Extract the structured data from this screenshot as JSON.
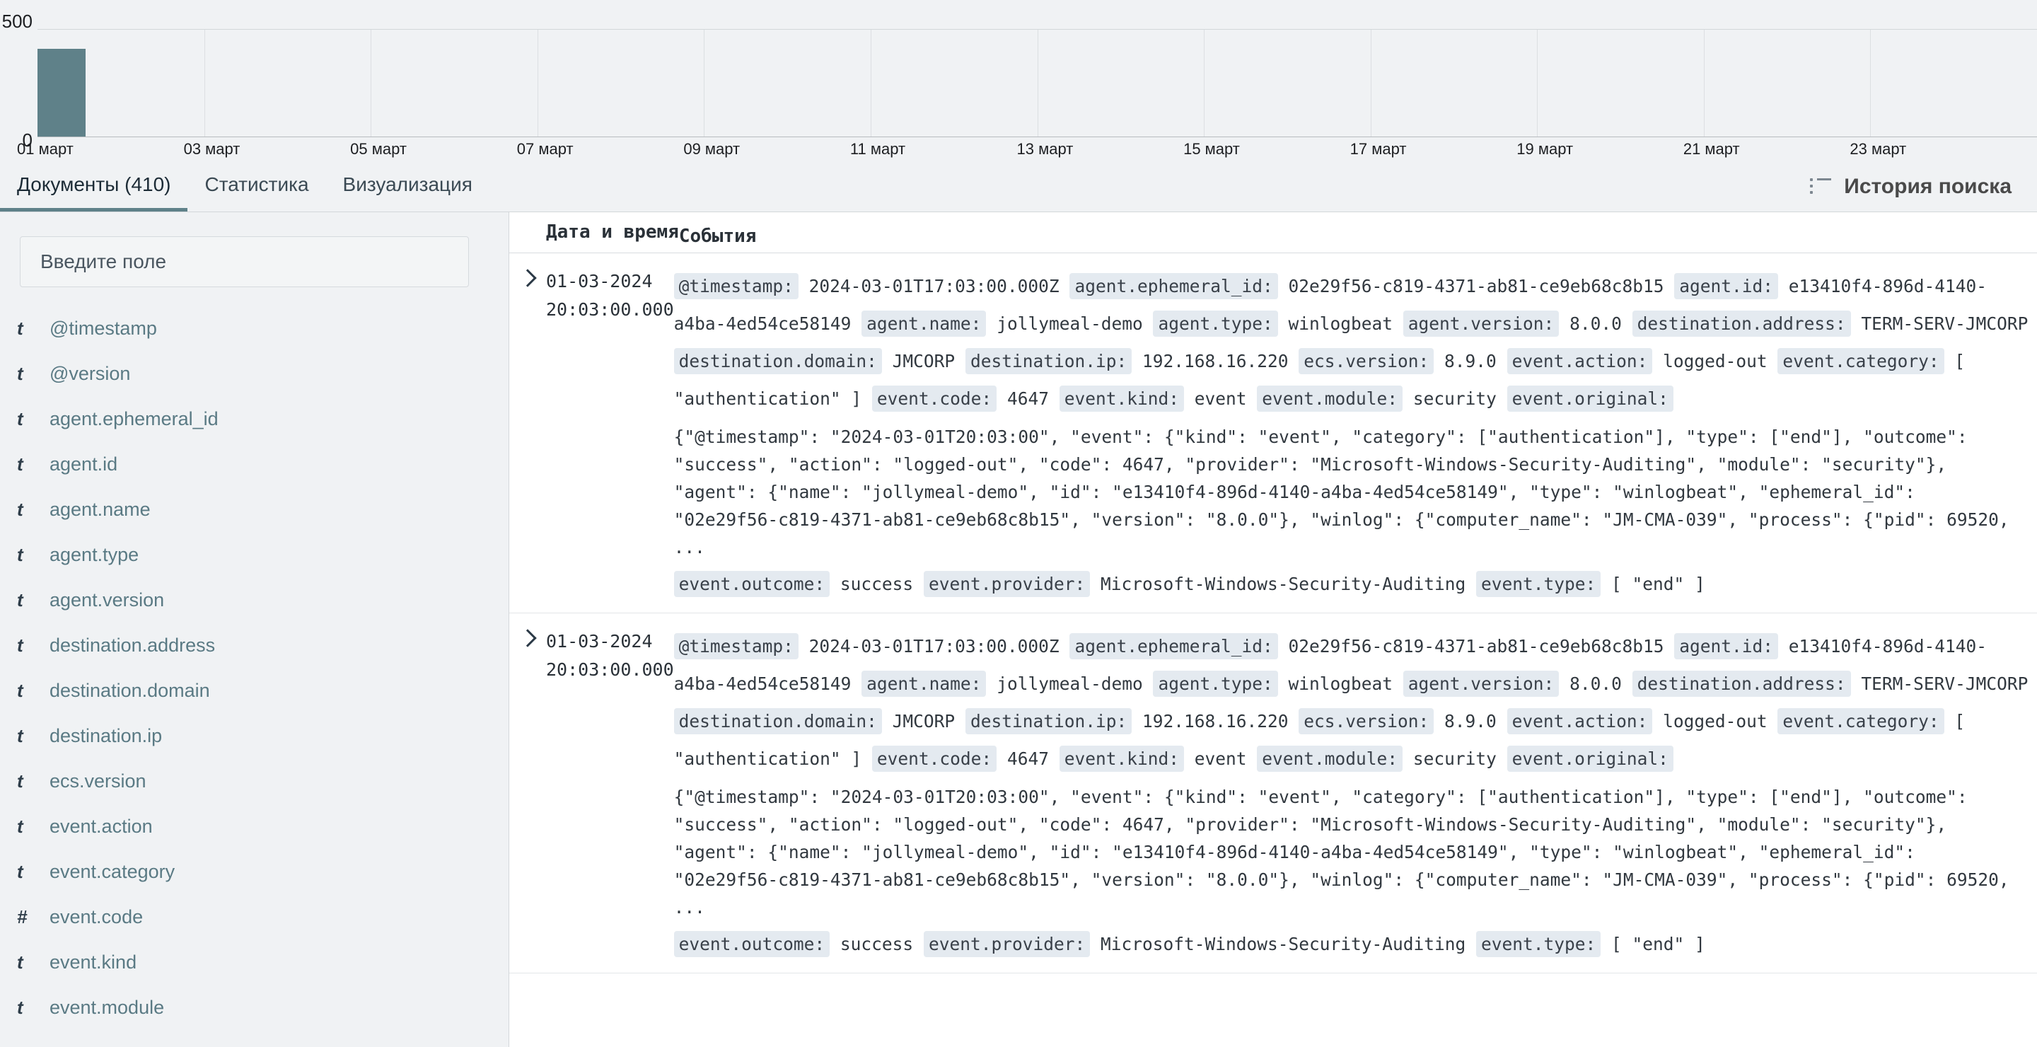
{
  "chart_data": {
    "type": "bar",
    "title": "",
    "xlabel": "",
    "ylabel": "",
    "categories": [
      "01 март",
      "03 март",
      "05 март",
      "07 март",
      "09 март",
      "11 март",
      "13 март",
      "15 март",
      "17 март",
      "19 март",
      "21 март",
      "23 март"
    ],
    "ticks": [
      "01 март",
      "03 март",
      "05 март",
      "07 март",
      "09 март",
      "11 март",
      "13 март",
      "15 март",
      "17 март",
      "19 март",
      "21 март",
      "23 март"
    ],
    "ylim": [
      0,
      500
    ],
    "ytick_labels": [
      "500",
      "0"
    ],
    "grid": true,
    "legend": "none",
    "bars": [
      {
        "label": "01 март",
        "value": 410,
        "color": "#5f8189"
      }
    ],
    "bar_color": "#5f8189"
  },
  "tabs": [
    {
      "label": "Документы (410)",
      "active": true
    },
    {
      "label": "Статистика",
      "active": false
    },
    {
      "label": "Визуализация",
      "active": false
    }
  ],
  "header": {
    "search_history_label": "История поиска",
    "search_history_icon": "list-icon"
  },
  "sidebar": {
    "search_placeholder": "Введите поле",
    "search_value": "",
    "fields": [
      {
        "type": "t",
        "name": "@timestamp"
      },
      {
        "type": "t",
        "name": "@version"
      },
      {
        "type": "t",
        "name": "agent.ephemeral_id"
      },
      {
        "type": "t",
        "name": "agent.id"
      },
      {
        "type": "t",
        "name": "agent.name"
      },
      {
        "type": "t",
        "name": "agent.type"
      },
      {
        "type": "t",
        "name": "agent.version"
      },
      {
        "type": "t",
        "name": "destination.address"
      },
      {
        "type": "t",
        "name": "destination.domain"
      },
      {
        "type": "t",
        "name": "destination.ip"
      },
      {
        "type": "t",
        "name": "ecs.version"
      },
      {
        "type": "t",
        "name": "event.action"
      },
      {
        "type": "t",
        "name": "event.category"
      },
      {
        "type": "#",
        "name": "event.code"
      },
      {
        "type": "t",
        "name": "event.kind"
      },
      {
        "type": "t",
        "name": "event.module"
      }
    ]
  },
  "table": {
    "columns": {
      "time": "Дата и время",
      "events": "События"
    },
    "rows": [
      {
        "date": "01-03-2024",
        "time": "20:03:00.000",
        "pairs_line1": [
          {
            "key": "@timestamp:",
            "val": "2024-03-01T17:03:00.000Z"
          },
          {
            "key": "agent.ephemeral_id:",
            "val": "02e29f56-c819-4371-ab81-ce9eb68c8b15"
          },
          {
            "key": "agent.id:",
            "val": ""
          }
        ],
        "pairs_line2": [
          {
            "key": "",
            "val": "e13410f4-896d-4140-a4ba-4ed54ce58149"
          },
          {
            "key": "agent.name:",
            "val": "jollymeal-demo"
          },
          {
            "key": "agent.type:",
            "val": "winlogbeat"
          },
          {
            "key": "agent.version:",
            "val": "8.0.0"
          }
        ],
        "pairs_line3": [
          {
            "key": "destination.address:",
            "val": "TERM-SERV-JMCORP"
          },
          {
            "key": "destination.domain:",
            "val": "JMCORP"
          },
          {
            "key": "destination.ip:",
            "val": "192.168.16.220"
          },
          {
            "key": "ecs.version:",
            "val": "8.9.0"
          }
        ],
        "pairs_line4": [
          {
            "key": "event.action:",
            "val": "logged-out"
          },
          {
            "key": "event.category:",
            "val": "[ \"authentication\" ]"
          },
          {
            "key": "event.code:",
            "val": "4647"
          },
          {
            "key": "event.kind:",
            "val": "event"
          },
          {
            "key": "event.module:",
            "val": ""
          }
        ],
        "pairs_line5": [
          {
            "key": "",
            "val": "security"
          },
          {
            "key": "event.original:",
            "val": ""
          }
        ],
        "json_original": "{\"@timestamp\": \"2024-03-01T20:03:00\", \"event\": {\"kind\": \"event\", \"category\": [\"authentication\"], \"type\": [\"end\"], \"outcome\": \"success\", \"action\": \"logged-out\", \"code\": 4647, \"provider\": \"Microsoft-Windows-Security-Auditing\", \"module\": \"security\"}, \"agent\": {\"name\": \"jollymeal-demo\", \"id\": \"e13410f4-896d-4140-a4ba-4ed54ce58149\", \"type\": \"winlogbeat\", \"ephemeral_id\": \"02e29f56-c819-4371-ab81-ce9eb68c8b15\", \"version\": \"8.0.0\"}, \"winlog\": {\"computer_name\": \"JM-CMA-039\", \"process\": {\"pid\": 69520, ...",
        "pairs_line6": [
          {
            "key": "event.outcome:",
            "val": "success"
          },
          {
            "key": "event.provider:",
            "val": "Microsoft-Windows-Security-Auditing"
          },
          {
            "key": "event.type:",
            "val": "[ \"end\" ]"
          }
        ]
      },
      {
        "date": "01-03-2024",
        "time": "20:03:00.000",
        "pairs_line1": [
          {
            "key": "@timestamp:",
            "val": "2024-03-01T17:03:00.000Z"
          },
          {
            "key": "agent.ephemeral_id:",
            "val": "02e29f56-c819-4371-ab81-ce9eb68c8b15"
          },
          {
            "key": "agent.id:",
            "val": ""
          }
        ],
        "pairs_line2": [
          {
            "key": "",
            "val": "e13410f4-896d-4140-a4ba-4ed54ce58149"
          },
          {
            "key": "agent.name:",
            "val": "jollymeal-demo"
          },
          {
            "key": "agent.type:",
            "val": "winlogbeat"
          },
          {
            "key": "agent.version:",
            "val": "8.0.0"
          }
        ],
        "pairs_line3": [
          {
            "key": "destination.address:",
            "val": "TERM-SERV-JMCORP"
          },
          {
            "key": "destination.domain:",
            "val": "JMCORP"
          },
          {
            "key": "destination.ip:",
            "val": "192.168.16.220"
          },
          {
            "key": "ecs.version:",
            "val": "8.9.0"
          }
        ],
        "pairs_line4": [
          {
            "key": "event.action:",
            "val": "logged-out"
          },
          {
            "key": "event.category:",
            "val": "[ \"authentication\" ]"
          },
          {
            "key": "event.code:",
            "val": "4647"
          },
          {
            "key": "event.kind:",
            "val": "event"
          },
          {
            "key": "event.module:",
            "val": ""
          }
        ],
        "pairs_line5": [
          {
            "key": "",
            "val": "security"
          },
          {
            "key": "event.original:",
            "val": ""
          }
        ],
        "json_original": "{\"@timestamp\": \"2024-03-01T20:03:00\", \"event\": {\"kind\": \"event\", \"category\": [\"authentication\"], \"type\": [\"end\"], \"outcome\": \"success\", \"action\": \"logged-out\", \"code\": 4647, \"provider\": \"Microsoft-Windows-Security-Auditing\", \"module\": \"security\"}, \"agent\": {\"name\": \"jollymeal-demo\", \"id\": \"e13410f4-896d-4140-a4ba-4ed54ce58149\", \"type\": \"winlogbeat\", \"ephemeral_id\": \"02e29f56-c819-4371-ab81-ce9eb68c8b15\", \"version\": \"8.0.0\"}, \"winlog\": {\"computer_name\": \"JM-CMA-039\", \"process\": {\"pid\": 69520, ...",
        "pairs_line6": [
          {
            "key": "event.outcome:",
            "val": "success"
          },
          {
            "key": "event.provider:",
            "val": "Microsoft-Windows-Security-Auditing"
          },
          {
            "key": "event.type:",
            "val": "[ \"end\" ]"
          }
        ]
      }
    ]
  }
}
